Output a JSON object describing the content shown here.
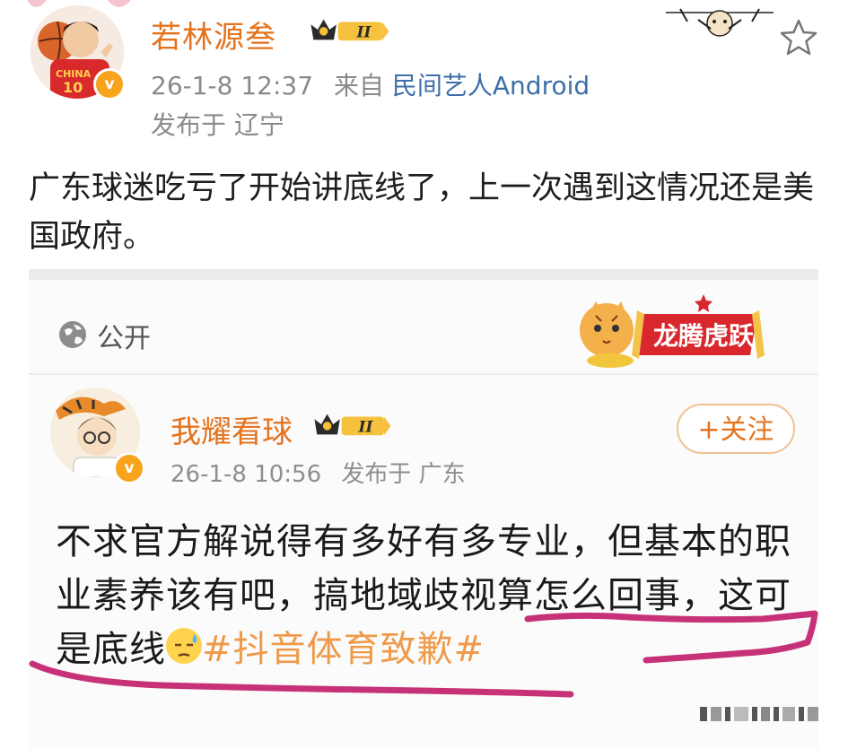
{
  "post": {
    "username": "若林源叁",
    "level_badge": "II",
    "time": "26-1-8 12:37",
    "via_label": "来自",
    "source": "民间艺人Android",
    "location": "发布于 辽宁",
    "verified_badge": "v",
    "jersey_text": "CHINA",
    "jersey_number": "10",
    "body": "广东球迷吃亏了开始讲底线了，上一次遇到这情况还是美国政府。"
  },
  "embedded": {
    "visibility_label": "公开",
    "festive_text": "龙腾虎跃",
    "author": {
      "name": "我耀看球",
      "level_badge": "II",
      "time": "26-1-8 10:56",
      "location": "发布于 广东",
      "follow_label": "+关注",
      "verified_badge": "v"
    },
    "text_main": "不求官方解说得有多好有多专业，但基本的职业素养该有吧，搞地域歧视算怎么回事，这可是底线",
    "hashtag": "#抖音体育致歉#"
  },
  "colors": {
    "username": "#e5731e",
    "link": "#3d6ea8",
    "meta": "#8a8a8a",
    "hashtag": "#ef9a4a",
    "annotation": "#c21f6b"
  },
  "icons": [
    "star-icon",
    "globe-icon",
    "crown-badge-icon",
    "verified-icon",
    "sweat-emoji-icon"
  ]
}
